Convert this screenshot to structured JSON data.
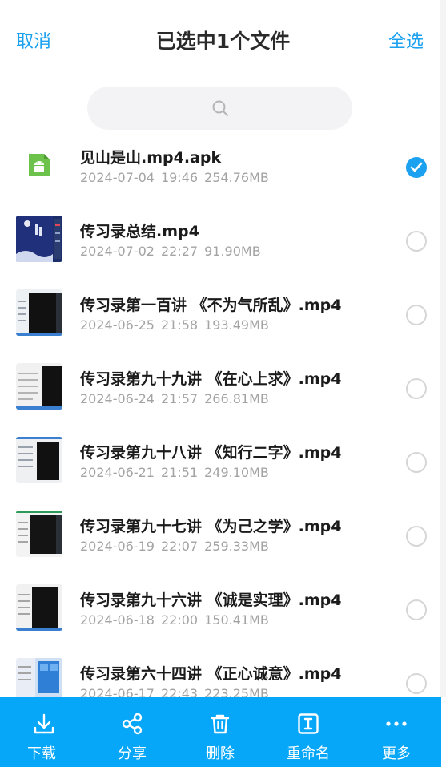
{
  "header": {
    "cancel_label": "取消",
    "title": "已选中1个文件",
    "select_all_label": "全选"
  },
  "search": {
    "icon": "search-icon"
  },
  "files": [
    {
      "name": "见山是山.mp4.apk",
      "date": "2024-07-04",
      "time": "19:46",
      "size": "254.76MB",
      "selected": true,
      "thumb": "android-apk-icon"
    },
    {
      "name": "传习录总结.mp4",
      "date": "2024-07-02",
      "time": "22:27",
      "size": "91.90MB",
      "selected": false,
      "thumb": "video-thumbnail"
    },
    {
      "name": "传习录第一百讲 《不为气所乱》.mp4",
      "date": "2024-06-25",
      "time": "21:58",
      "size": "193.49MB",
      "selected": false,
      "thumb": "video-thumbnail"
    },
    {
      "name": "传习录第九十九讲 《在心上求》.mp4",
      "date": "2024-06-24",
      "time": "21:57",
      "size": "266.81MB",
      "selected": false,
      "thumb": "video-thumbnail"
    },
    {
      "name": "传习录第九十八讲 《知行二字》.mp4",
      "date": "2024-06-21",
      "time": "21:51",
      "size": "249.10MB",
      "selected": false,
      "thumb": "video-thumbnail"
    },
    {
      "name": "传习录第九十七讲 《为己之学》.mp4",
      "date": "2024-06-19",
      "time": "22:07",
      "size": "259.33MB",
      "selected": false,
      "thumb": "video-thumbnail"
    },
    {
      "name": "传习录第九十六讲 《诚是实理》.mp4",
      "date": "2024-06-18",
      "time": "22:00",
      "size": "150.41MB",
      "selected": false,
      "thumb": "video-thumbnail"
    },
    {
      "name": "传习录第六十四讲 《正心诚意》.mp4",
      "date": "2024-06-17",
      "time": "22:43",
      "size": "223.25MB",
      "selected": false,
      "thumb": "video-thumbnail"
    }
  ],
  "toolbar": {
    "download_label": "下载",
    "share_label": "分享",
    "delete_label": "删除",
    "rename_label": "重命名",
    "more_label": "更多"
  },
  "colors": {
    "accent": "#1ba1f0",
    "toolbar_bg": "#06a7f8",
    "apk_green": "#6cc24a"
  }
}
